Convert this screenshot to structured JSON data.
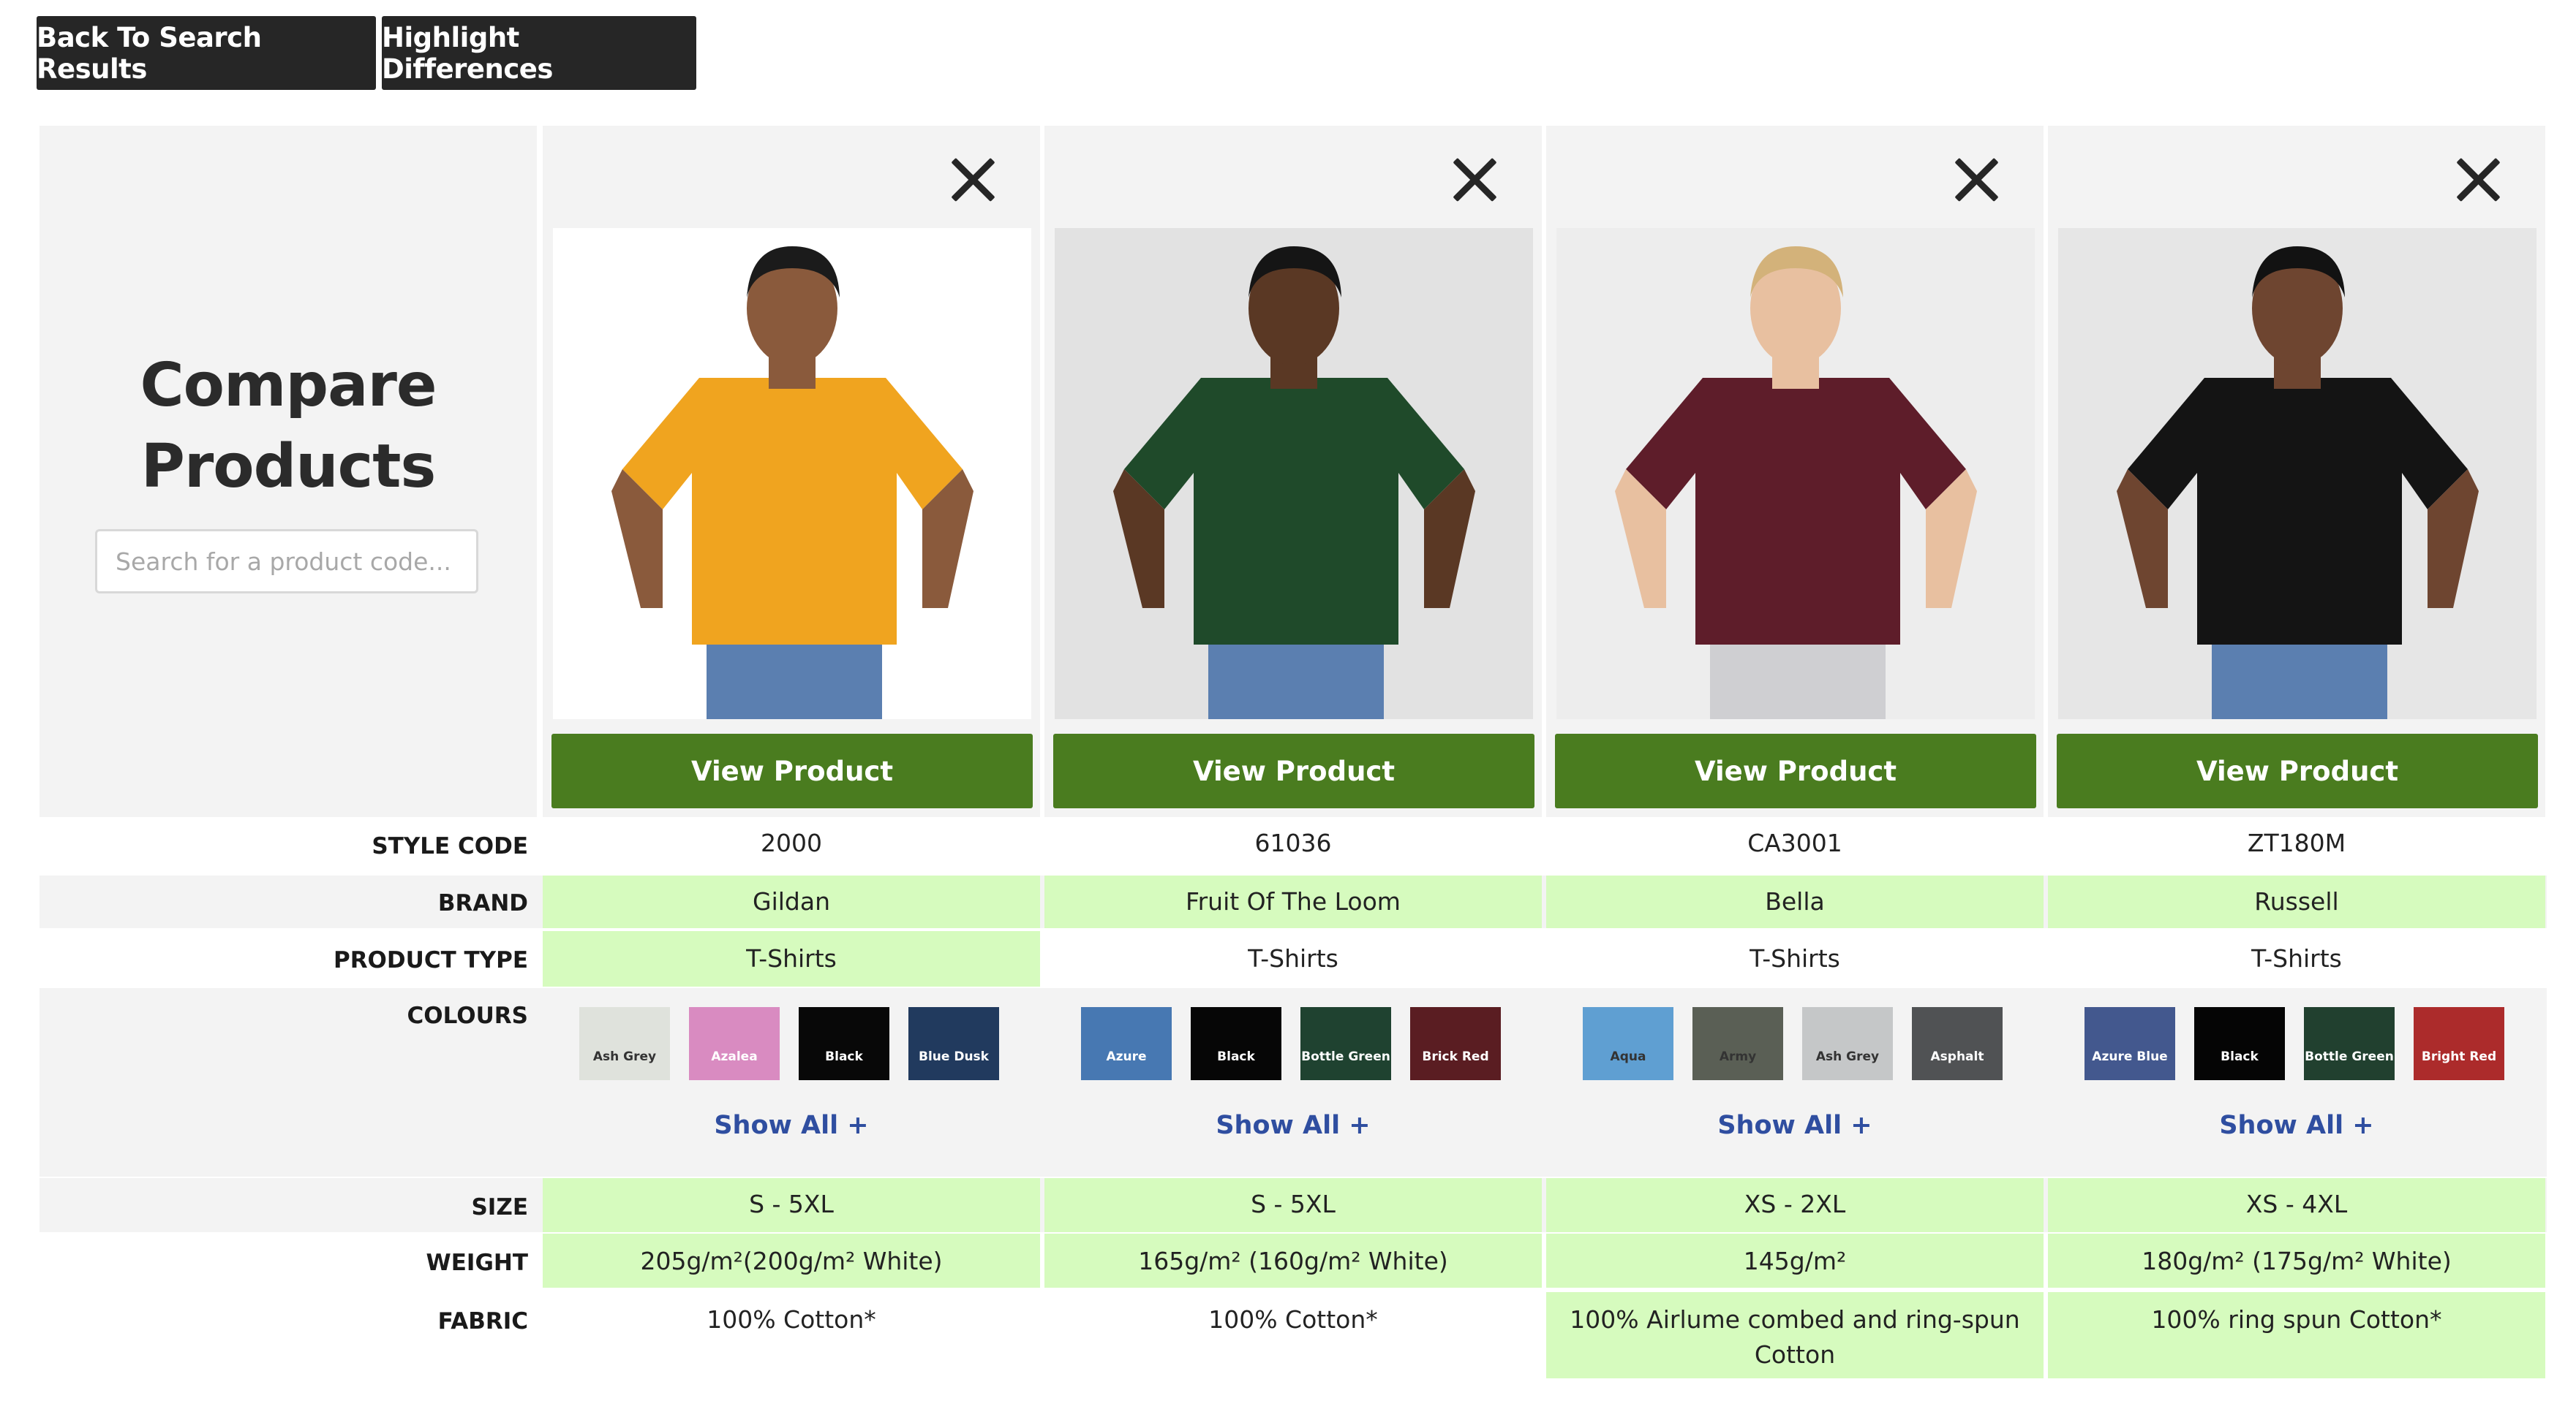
{
  "toolbar": {
    "back_label": "Back To Search Results",
    "highlight_label": "Highlight Differences"
  },
  "header": {
    "title_line1": "Compare",
    "title_line2": "Products",
    "search_placeholder": "Search for a product code..."
  },
  "rows": {
    "style_code": "STYLE CODE",
    "brand": "BRAND",
    "product_type": "PRODUCT TYPE",
    "colours": "COLOURS",
    "size": "SIZE",
    "weight": "WEIGHT",
    "fabric": "FABRIC"
  },
  "view_label": "View Product",
  "show_all_label": "Show All +",
  "products": [
    {
      "style_code": "2000",
      "brand": "Gildan",
      "product_type": "T-Shirts",
      "size": "S - 5XL",
      "weight": "205g/m²(200g/m² White)",
      "fabric": "100% Cotton*",
      "shirt_color": "#f0a41f",
      "photo_bg": "#ffffff",
      "swatches": [
        {
          "name": "Ash Grey",
          "color": "#dfe2dc",
          "dark_text": true
        },
        {
          "name": "Azalea",
          "color": "#d98bc1",
          "dark_text": false
        },
        {
          "name": "Black",
          "color": "#080808",
          "dark_text": false
        },
        {
          "name": "Blue Dusk",
          "color": "#213a5e",
          "dark_text": false
        }
      ]
    },
    {
      "style_code": "61036",
      "brand": "Fruit Of The Loom",
      "product_type": "T-Shirts",
      "size": "S - 5XL",
      "weight": "165g/m² (160g/m² White)",
      "fabric": "100% Cotton*",
      "shirt_color": "#1f4a2a",
      "photo_bg": "#e2e2e2",
      "swatches": [
        {
          "name": "Azure",
          "color": "#4778b2",
          "dark_text": false
        },
        {
          "name": "Black",
          "color": "#060606",
          "dark_text": false
        },
        {
          "name": "Bottle Green",
          "color": "#1f4230",
          "dark_text": false
        },
        {
          "name": "Brick Red",
          "color": "#5a1d22",
          "dark_text": false
        }
      ]
    },
    {
      "style_code": "CA3001",
      "brand": "Bella",
      "product_type": "T-Shirts",
      "size": "XS - 2XL",
      "weight": "145g/m²",
      "fabric": "100% Airlume combed and ring-spun Cotton",
      "shirt_color": "#5e1d2a",
      "photo_bg": "#ededed",
      "swatches": [
        {
          "name": "Aqua",
          "color": "#5f9fd2",
          "dark_text": true
        },
        {
          "name": "Army",
          "color": "#5a5f55",
          "dark_text": true
        },
        {
          "name": "Ash Grey",
          "color": "#c5c7c8",
          "dark_text": true
        },
        {
          "name": "Asphalt",
          "color": "#505254",
          "dark_text": false
        }
      ]
    },
    {
      "style_code": "ZT180M",
      "brand": "Russell",
      "product_type": "T-Shirts",
      "size": "XS - 4XL",
      "weight": "180g/m² (175g/m² White)",
      "fabric": "100% ring spun Cotton*",
      "shirt_color": "#141414",
      "photo_bg": "#e6e6e6",
      "swatches": [
        {
          "name": "Azure Blue",
          "color": "#43588e",
          "dark_text": false
        },
        {
          "name": "Black",
          "color": "#050505",
          "dark_text": false
        },
        {
          "name": "Bottle Green",
          "color": "#21402f",
          "dark_text": false
        },
        {
          "name": "Bright Red",
          "color": "#ac2b2b",
          "dark_text": false
        }
      ]
    }
  ]
}
